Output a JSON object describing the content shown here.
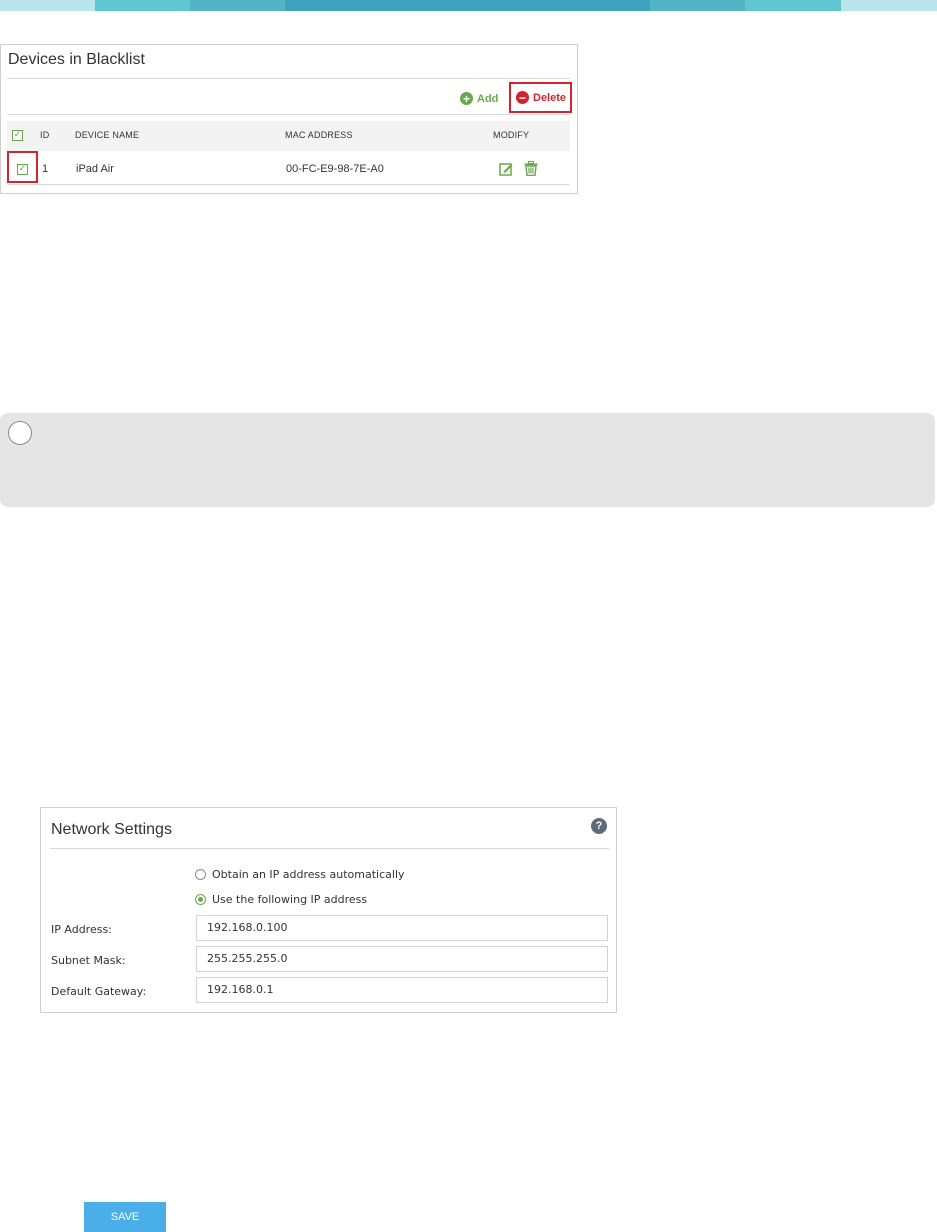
{
  "theme": {
    "accent_green": "#6aa84f",
    "danger_red": "#d0242f",
    "save_blue": "#4aaee8",
    "band_colors": [
      "#b9e6ea",
      "#5ec7cf",
      "#54b4c3",
      "#3ea4bd",
      "#54b4c3",
      "#5ec7cf",
      "#b9e6ea"
    ]
  },
  "blacklist": {
    "title": "Devices in Blacklist",
    "add_label": "Add",
    "delete_label": "Delete",
    "add_icon": "plus-circle-icon",
    "delete_icon": "minus-circle-icon",
    "columns": {
      "select": "checkbox",
      "id": "ID",
      "device_name": "DEVICE NAME",
      "mac_address": "MAC ADDRESS",
      "modify": "MODIFY"
    },
    "rows": [
      {
        "checked": true,
        "id": "1",
        "device_name": "iPad Air",
        "mac_address": "00-FC-E9-98-7E-A0",
        "icons": [
          "edit-icon",
          "trash-icon"
        ]
      }
    ]
  },
  "note": {
    "icon": "info-circle-icon"
  },
  "network": {
    "title": "Network Settings",
    "help_icon": "?",
    "radio_auto": "Obtain an IP address automatically",
    "radio_manual": "Use the following IP address",
    "selected": "manual",
    "ip_label": "IP Address:",
    "ip_value": "192.168.0.100",
    "mask_label": "Subnet Mask:",
    "mask_value": "255.255.255.0",
    "gateway_label": "Default Gateway:",
    "gateway_value": "192.168.0.1"
  },
  "actions": {
    "save_label": "SAVE"
  }
}
